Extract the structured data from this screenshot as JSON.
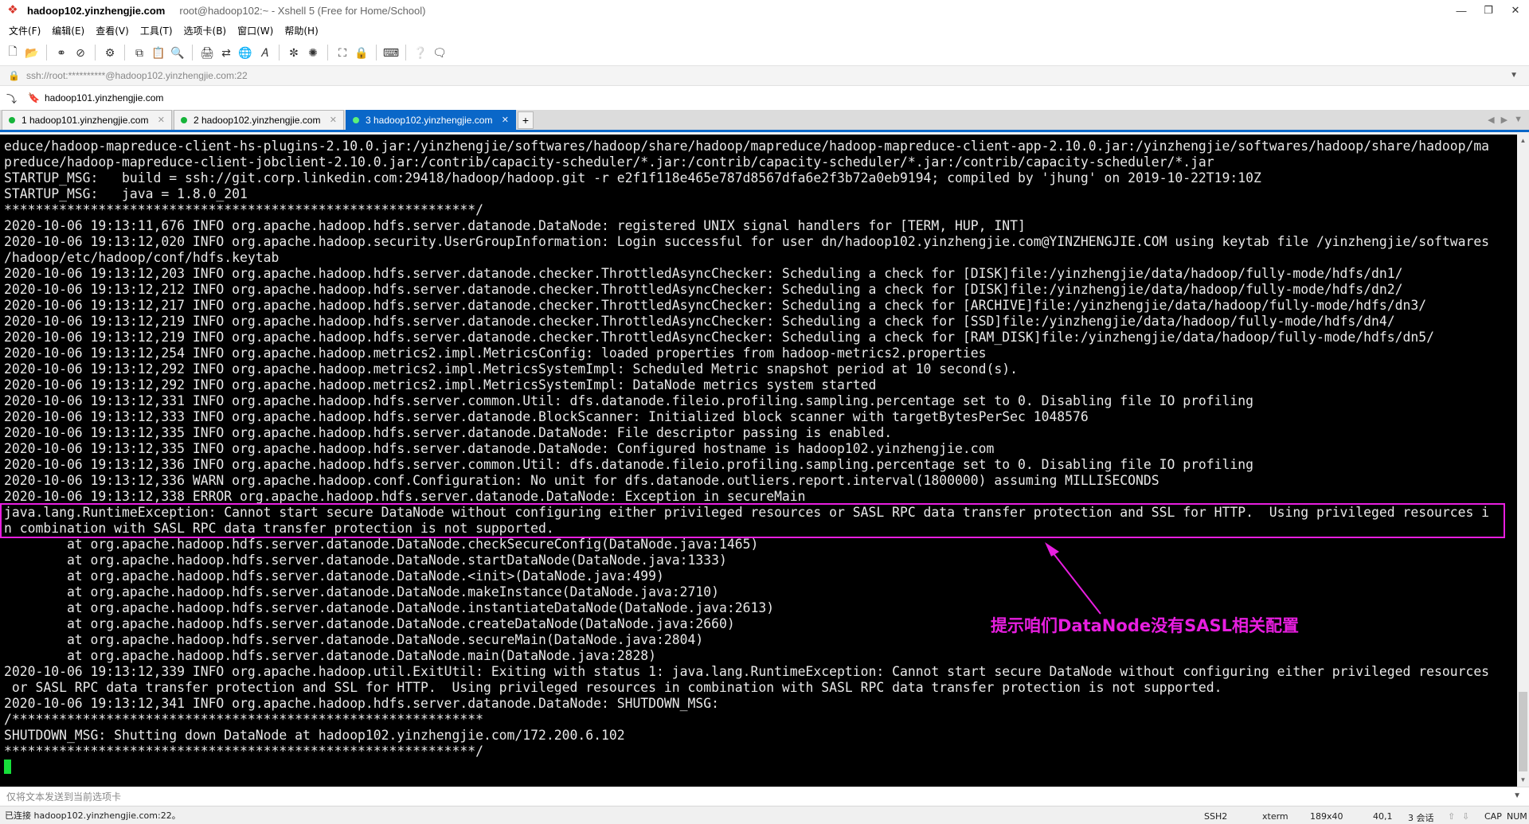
{
  "window": {
    "title_host": "hadoop102.yinzhengjie.com",
    "title_rest": "root@hadoop102:~ - Xshell 5 (Free for Home/School)",
    "app_icon": "xshell-icon"
  },
  "menu": {
    "items": [
      "文件(F)",
      "编辑(E)",
      "查看(V)",
      "工具(T)",
      "选项卡(B)",
      "窗口(W)",
      "帮助(H)"
    ]
  },
  "toolbar": {
    "icons": [
      "new-session-icon",
      "open-folder-icon",
      "reconnect-icon",
      "disconnect-icon",
      "properties-icon",
      "copy-icon",
      "paste-icon",
      "find-icon",
      "print-icon",
      "transfer-icon",
      "globe-icon",
      "font-icon",
      "xftp-icon",
      "xmanager-icon",
      "fullscreen-icon",
      "lock-icon",
      "keyboard-icon",
      "help-icon",
      "chat-icon"
    ]
  },
  "address": {
    "text": "ssh://root:**********@hadoop102.yinzhengjie.com:22"
  },
  "links": {
    "bookmark": "hadoop101.yinzhengjie.com"
  },
  "tabs": [
    {
      "label": "1 hadoop101.yinzhengjie.com",
      "active": false
    },
    {
      "label": "2 hadoop102.yinzhengjie.com",
      "active": false
    },
    {
      "label": "3 hadoop102.yinzhengjie.com",
      "active": true
    }
  ],
  "terminal": {
    "lines": [
      "educe/hadoop-mapreduce-client-hs-plugins-2.10.0.jar:/yinzhengjie/softwares/hadoop/share/hadoop/mapreduce/hadoop-mapreduce-client-app-2.10.0.jar:/yinzhengjie/softwares/hadoop/share/hadoop/ma",
      "preduce/hadoop-mapreduce-client-jobclient-2.10.0.jar:/contrib/capacity-scheduler/*.jar:/contrib/capacity-scheduler/*.jar:/contrib/capacity-scheduler/*.jar",
      "STARTUP_MSG:   build = ssh://git.corp.linkedin.com:29418/hadoop/hadoop.git -r e2f1f118e465e787d8567dfa6e2f3b72a0eb9194; compiled by 'jhung' on 2019-10-22T19:10Z",
      "STARTUP_MSG:   java = 1.8.0_201",
      "************************************************************/",
      "2020-10-06 19:13:11,676 INFO org.apache.hadoop.hdfs.server.datanode.DataNode: registered UNIX signal handlers for [TERM, HUP, INT]",
      "2020-10-06 19:13:12,020 INFO org.apache.hadoop.security.UserGroupInformation: Login successful for user dn/hadoop102.yinzhengjie.com@YINZHENGJIE.COM using keytab file /yinzhengjie/softwares",
      "/hadoop/etc/hadoop/conf/hdfs.keytab",
      "2020-10-06 19:13:12,203 INFO org.apache.hadoop.hdfs.server.datanode.checker.ThrottledAsyncChecker: Scheduling a check for [DISK]file:/yinzhengjie/data/hadoop/fully-mode/hdfs/dn1/",
      "2020-10-06 19:13:12,212 INFO org.apache.hadoop.hdfs.server.datanode.checker.ThrottledAsyncChecker: Scheduling a check for [DISK]file:/yinzhengjie/data/hadoop/fully-mode/hdfs/dn2/",
      "2020-10-06 19:13:12,217 INFO org.apache.hadoop.hdfs.server.datanode.checker.ThrottledAsyncChecker: Scheduling a check for [ARCHIVE]file:/yinzhengjie/data/hadoop/fully-mode/hdfs/dn3/",
      "2020-10-06 19:13:12,219 INFO org.apache.hadoop.hdfs.server.datanode.checker.ThrottledAsyncChecker: Scheduling a check for [SSD]file:/yinzhengjie/data/hadoop/fully-mode/hdfs/dn4/",
      "2020-10-06 19:13:12,219 INFO org.apache.hadoop.hdfs.server.datanode.checker.ThrottledAsyncChecker: Scheduling a check for [RAM_DISK]file:/yinzhengjie/data/hadoop/fully-mode/hdfs/dn5/",
      "2020-10-06 19:13:12,254 INFO org.apache.hadoop.metrics2.impl.MetricsConfig: loaded properties from hadoop-metrics2.properties",
      "2020-10-06 19:13:12,292 INFO org.apache.hadoop.metrics2.impl.MetricsSystemImpl: Scheduled Metric snapshot period at 10 second(s).",
      "2020-10-06 19:13:12,292 INFO org.apache.hadoop.metrics2.impl.MetricsSystemImpl: DataNode metrics system started",
      "2020-10-06 19:13:12,331 INFO org.apache.hadoop.hdfs.server.common.Util: dfs.datanode.fileio.profiling.sampling.percentage set to 0. Disabling file IO profiling",
      "2020-10-06 19:13:12,333 INFO org.apache.hadoop.hdfs.server.datanode.BlockScanner: Initialized block scanner with targetBytesPerSec 1048576",
      "2020-10-06 19:13:12,335 INFO org.apache.hadoop.hdfs.server.datanode.DataNode: File descriptor passing is enabled.",
      "2020-10-06 19:13:12,335 INFO org.apache.hadoop.hdfs.server.datanode.DataNode: Configured hostname is hadoop102.yinzhengjie.com",
      "2020-10-06 19:13:12,336 INFO org.apache.hadoop.hdfs.server.common.Util: dfs.datanode.fileio.profiling.sampling.percentage set to 0. Disabling file IO profiling",
      "2020-10-06 19:13:12,336 WARN org.apache.hadoop.conf.Configuration: No unit for dfs.datanode.outliers.report.interval(1800000) assuming MILLISECONDS",
      "2020-10-06 19:13:12,338 ERROR org.apache.hadoop.hdfs.server.datanode.DataNode: Exception in secureMain",
      "java.lang.RuntimeException: Cannot start secure DataNode without configuring either privileged resources or SASL RPC data transfer protection and SSL for HTTP.  Using privileged resources i",
      "n combination with SASL RPC data transfer protection is not supported.",
      "        at org.apache.hadoop.hdfs.server.datanode.DataNode.checkSecureConfig(DataNode.java:1465)",
      "        at org.apache.hadoop.hdfs.server.datanode.DataNode.startDataNode(DataNode.java:1333)",
      "        at org.apache.hadoop.hdfs.server.datanode.DataNode.<init>(DataNode.java:499)",
      "        at org.apache.hadoop.hdfs.server.datanode.DataNode.makeInstance(DataNode.java:2710)",
      "        at org.apache.hadoop.hdfs.server.datanode.DataNode.instantiateDataNode(DataNode.java:2613)",
      "        at org.apache.hadoop.hdfs.server.datanode.DataNode.createDataNode(DataNode.java:2660)",
      "        at org.apache.hadoop.hdfs.server.datanode.DataNode.secureMain(DataNode.java:2804)",
      "        at org.apache.hadoop.hdfs.server.datanode.DataNode.main(DataNode.java:2828)",
      "2020-10-06 19:13:12,339 INFO org.apache.hadoop.util.ExitUtil: Exiting with status 1: java.lang.RuntimeException: Cannot start secure DataNode without configuring either privileged resources",
      " or SASL RPC data transfer protection and SSL for HTTP.  Using privileged resources in combination with SASL RPC data transfer protection is not supported.",
      "2020-10-06 19:13:12,341 INFO org.apache.hadoop.hdfs.server.datanode.DataNode: SHUTDOWN_MSG:",
      "/************************************************************",
      "SHUTDOWN_MSG: Shutting down DataNode at hadoop102.yinzhengjie.com/172.200.6.102",
      "************************************************************/"
    ],
    "annotation": "提示咱们DataNode没有SASL相关配置",
    "highlight_color": "#e81ee0",
    "cursor_color": "#16e03a"
  },
  "compose": {
    "placeholder": "仅将文本发送到当前选项卡"
  },
  "status": {
    "connection": "已连接 hadoop102.yinzhengjie.com:22。",
    "protocol": "SSH2",
    "terminal_type": "xterm",
    "size": "189x40",
    "cursor_pos": "40,1",
    "sessions": "3 会话",
    "caps": "CAP",
    "num": "NUM"
  }
}
